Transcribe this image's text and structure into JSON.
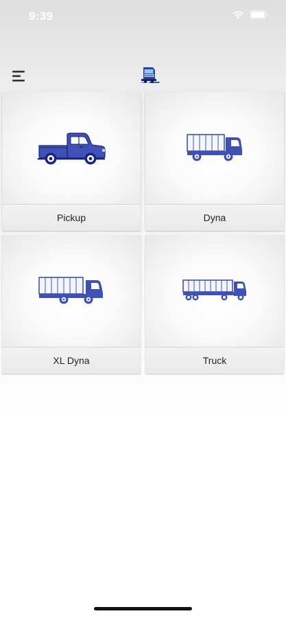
{
  "status_bar": {
    "time": "9:39",
    "icons": [
      "wifi-icon",
      "battery-icon"
    ]
  },
  "header": {
    "menu_icon": "menu-icon",
    "logo_icon": "truck-logo-icon"
  },
  "colors": {
    "vehicle_blue": "#3f51b5",
    "vehicle_dark": "#1a237e"
  },
  "vehicles": [
    {
      "label": "Pickup",
      "icon": "pickup-truck-icon"
    },
    {
      "label": "Dyna",
      "icon": "dyna-truck-icon"
    },
    {
      "label": "XL Dyna",
      "icon": "xl-dyna-truck-icon"
    },
    {
      "label": "Truck",
      "icon": "semi-truck-icon"
    }
  ]
}
